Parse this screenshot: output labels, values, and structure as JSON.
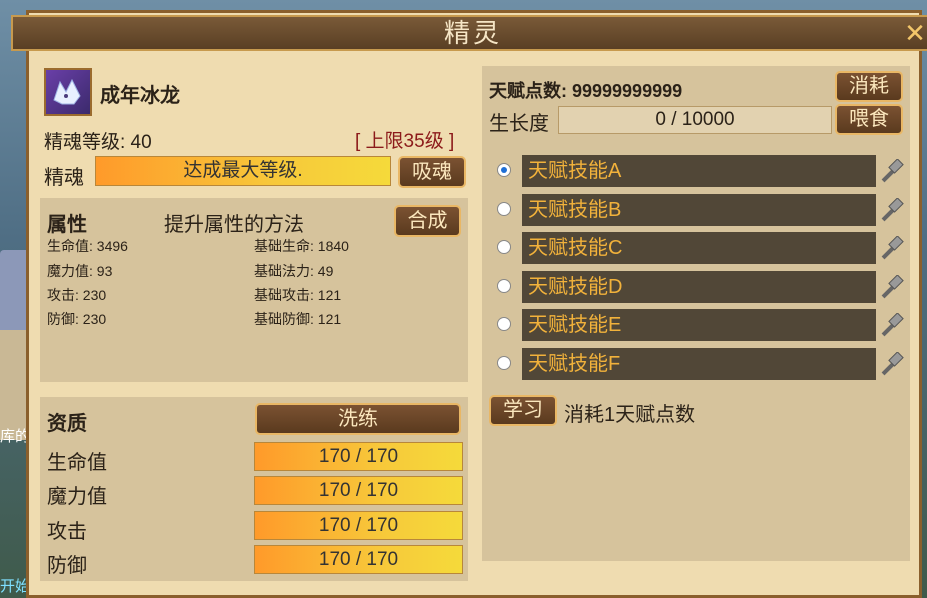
{
  "window": {
    "title": "精灵",
    "close_glyph": "✕"
  },
  "pet": {
    "name": "成年冰龙",
    "level_label": "精魂等级: 40",
    "level_cap": "[ 上限35级 ]",
    "soul_label": "精魂",
    "soul_bar_text": "达成最大等级.",
    "soul_bar_fraction": 1.0,
    "absorb_button": "吸魂"
  },
  "attributes": {
    "heading": "属性",
    "method_text": "提升属性的方法",
    "compose_button": "合成",
    "left": [
      "生命值: 3496",
      "魔力值: 93",
      "攻击: 230",
      "防御: 230"
    ],
    "right": [
      "基础生命: 1840",
      "基础法力: 49",
      "基础攻击: 121",
      "基础防御: 121"
    ]
  },
  "aptitude": {
    "heading": "资质",
    "refine_button": "洗练",
    "rows": [
      {
        "label": "生命值",
        "value": "170 / 170",
        "fraction": 1.0
      },
      {
        "label": "魔力值",
        "value": "170 / 170",
        "fraction": 1.0
      },
      {
        "label": "攻击",
        "value": "170 / 170",
        "fraction": 1.0
      },
      {
        "label": "防御",
        "value": "170 / 170",
        "fraction": 1.0
      }
    ]
  },
  "talent": {
    "points_label": "天赋点数: 99999999999",
    "consume_button": "消耗",
    "growth_label": "生长度",
    "growth_value": "0 / 10000",
    "growth_fraction": 0,
    "feed_button": "喂食",
    "skills": [
      {
        "label": "天赋技能A",
        "selected": true
      },
      {
        "label": "天赋技能B",
        "selected": false
      },
      {
        "label": "天赋技能C",
        "selected": false
      },
      {
        "label": "天赋技能D",
        "selected": false
      },
      {
        "label": "天赋技能E",
        "selected": false
      },
      {
        "label": "天赋技能F",
        "selected": false
      }
    ],
    "learn_button": "学习",
    "learn_cost": "消耗1天赋点数"
  },
  "background": {
    "sign_text": "库的",
    "bottom_text": "开始"
  },
  "colors": {
    "accent_gold": "#f2b23b",
    "panel": "#d6c39c",
    "frame": "#8a5f2c",
    "bar_orange": "#ff9a2a",
    "bar_yellow": "#f5da3a"
  }
}
